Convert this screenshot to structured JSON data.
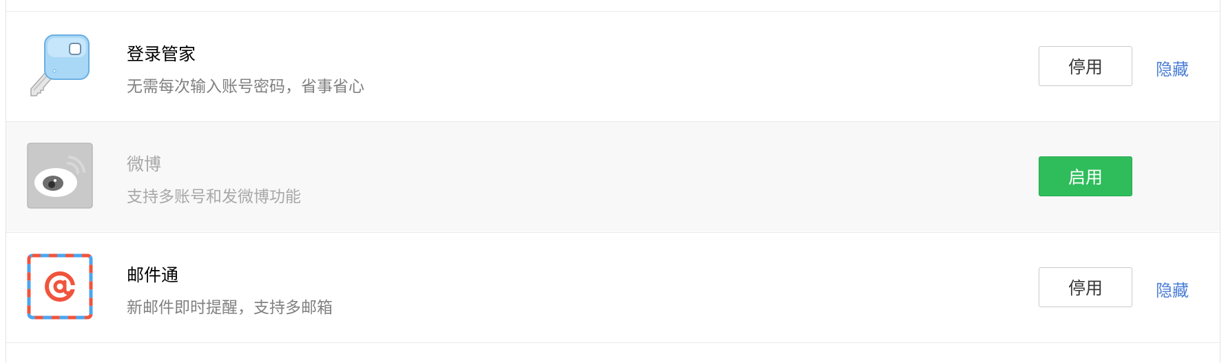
{
  "plugins": [
    {
      "name": "登录管家",
      "description": "无需每次输入账号密码，省事省心",
      "icon": "key-icon",
      "status": "enabled",
      "button_label": "停用",
      "hide_label": "隐藏"
    },
    {
      "name": "微博",
      "description": "支持多账号和发微博功能",
      "icon": "weibo-icon",
      "status": "disabled",
      "button_label": "启用"
    },
    {
      "name": "邮件通",
      "description": "新邮件即时提醒，支持多邮箱",
      "icon": "mail-at-icon",
      "status": "enabled",
      "button_label": "停用",
      "hide_label": "隐藏"
    }
  ],
  "colors": {
    "enable_button": "#2fbd5b",
    "link": "#4a7dd6",
    "disabled_row_bg": "#f8f8f8"
  }
}
